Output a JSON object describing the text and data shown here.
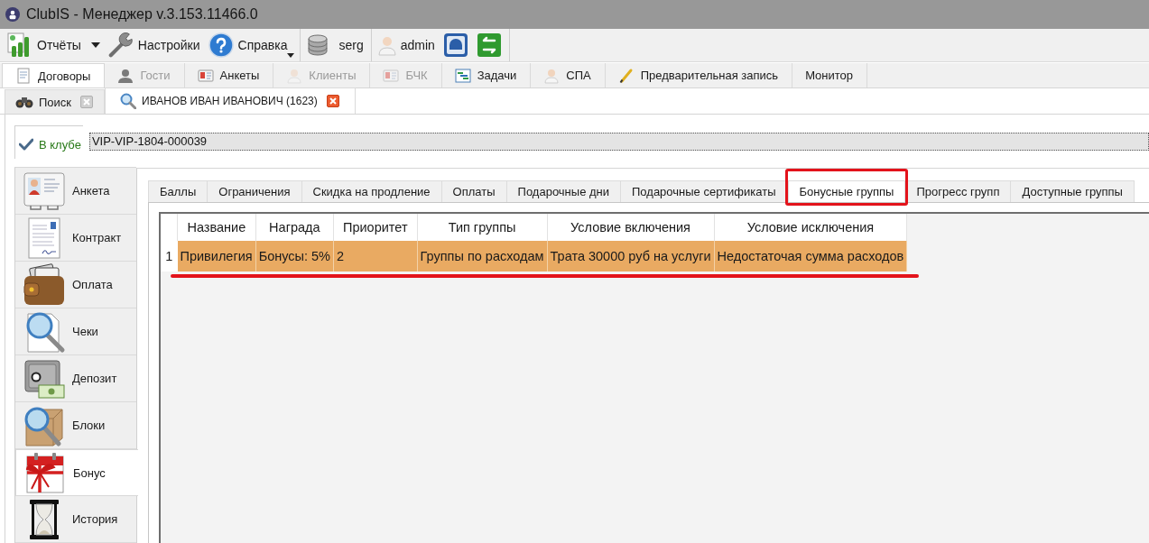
{
  "window": {
    "title": "ClubIS - Менеджер v.3.153.11466.0"
  },
  "toolbar": {
    "groups": [
      [
        {
          "kind": "menu",
          "label": "Отчёты"
        },
        {
          "kind": "button",
          "label": "Настройки"
        },
        {
          "kind": "split",
          "label": "Справка"
        }
      ],
      [
        {
          "kind": "button",
          "label": "serg"
        }
      ],
      [
        {
          "kind": "button",
          "label": "admin"
        },
        {
          "kind": "icon"
        },
        {
          "kind": "icon"
        }
      ]
    ]
  },
  "main_tabs": [
    {
      "label": "Договоры",
      "selected": true,
      "disabled": false
    },
    {
      "label": "Гости",
      "selected": false,
      "disabled": true
    },
    {
      "label": "Анкеты",
      "selected": false,
      "disabled": false
    },
    {
      "label": "Клиенты",
      "selected": false,
      "disabled": true
    },
    {
      "label": "БЧК",
      "selected": false,
      "disabled": true
    },
    {
      "label": "Задачи",
      "selected": false,
      "disabled": false
    },
    {
      "label": "СПА",
      "selected": false,
      "disabled": false
    },
    {
      "label": "Предварительная запись",
      "selected": false,
      "disabled": false
    },
    {
      "label": "Монитор",
      "selected": false,
      "disabled": false
    }
  ],
  "doc_tabs": [
    {
      "label": "Поиск",
      "selected": false
    },
    {
      "label": "ИВАНОВ ИВАН ИВАНОВИЧ (1623)",
      "selected": true
    }
  ],
  "status": {
    "checked": true,
    "label": "В клубе",
    "value": "VIP-VIP-1804-000039"
  },
  "sidebar": {
    "items": [
      {
        "label": "Анкета",
        "selected": false
      },
      {
        "label": "Контракт",
        "selected": false
      },
      {
        "label": "Оплата",
        "selected": false
      },
      {
        "label": "Чеки",
        "selected": false
      },
      {
        "label": "Депозит",
        "selected": false
      },
      {
        "label": "Блоки",
        "selected": false
      },
      {
        "label": "Бонус",
        "selected": true
      },
      {
        "label": "История",
        "selected": false
      }
    ]
  },
  "subtabs": [
    {
      "label": "Баллы",
      "selected": false,
      "highlighted": false
    },
    {
      "label": "Ограничения",
      "selected": false,
      "highlighted": false
    },
    {
      "label": "Скидка на продление",
      "selected": false,
      "highlighted": false
    },
    {
      "label": "Оплаты",
      "selected": false,
      "highlighted": false
    },
    {
      "label": "Подарочные дни",
      "selected": false,
      "highlighted": false
    },
    {
      "label": "Подарочные сертификаты",
      "selected": false,
      "highlighted": false
    },
    {
      "label": "Бонусные группы",
      "selected": true,
      "highlighted": true
    },
    {
      "label": "Прогресс групп",
      "selected": false,
      "highlighted": false
    },
    {
      "label": "Доступные группы",
      "selected": false,
      "highlighted": false
    }
  ],
  "table": {
    "columns": [
      "Название",
      "Награда",
      "Приоритет",
      "Тип группы",
      "Условие включения",
      "Условие исключения"
    ],
    "rows": [
      {
        "number": "1",
        "selected": true,
        "underlined": true,
        "cells": [
          "Привилегия",
          "Бонусы: 5%",
          "2",
          "Группы по расходам",
          "Трата 30000 руб на услуги",
          "Недостаточая сумма расходов"
        ]
      }
    ]
  }
}
